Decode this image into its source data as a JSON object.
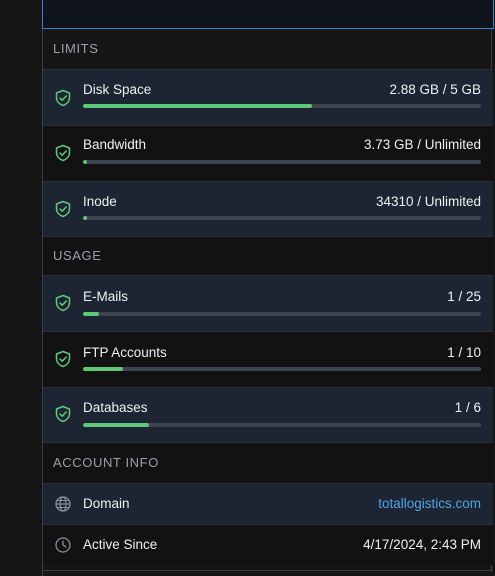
{
  "sections": {
    "limits": "LIMITS",
    "usage": "USAGE",
    "account_info": "ACCOUNT INFO"
  },
  "limits": [
    {
      "label": "Disk Space",
      "value": "2.88 GB / 5 GB",
      "progress": 0.576,
      "icon": "shield-check-icon"
    },
    {
      "label": "Bandwidth",
      "value": "3.73 GB / Unlimited",
      "progress": 0.01,
      "icon": "shield-check-icon"
    },
    {
      "label": "Inode",
      "value": "34310 / Unlimited",
      "progress": 0.01,
      "icon": "shield-check-icon"
    }
  ],
  "usage": [
    {
      "label": "E-Mails",
      "value": "1 / 25",
      "progress": 0.04,
      "icon": "shield-check-icon"
    },
    {
      "label": "FTP Accounts",
      "value": "1 / 10",
      "progress": 0.1,
      "icon": "shield-check-icon"
    },
    {
      "label": "Databases",
      "value": "1 / 6",
      "progress": 0.1667,
      "icon": "shield-check-icon"
    }
  ],
  "account_info": {
    "domain": {
      "label": "Domain",
      "value": "totallogistics.com",
      "icon": "globe-icon"
    },
    "active_since": {
      "label": "Active Since",
      "value": "4/17/2024, 2:43 PM",
      "icon": "clock-icon"
    }
  },
  "colors": {
    "accent_green": "#5ec97a",
    "link_blue": "#4da3e8",
    "row_stripe": "#1e2532",
    "background": "#161616"
  }
}
